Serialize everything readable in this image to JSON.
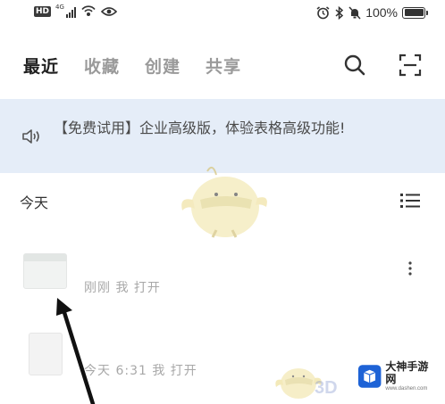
{
  "status_bar": {
    "hd_badge": "HD",
    "network_type": "4G",
    "battery_text": "100%",
    "battery_level": 1.0,
    "icons": [
      "hd-icon",
      "signal-icon",
      "wifi-hotspot-icon",
      "eye-icon",
      "alarm-icon",
      "bluetooth-icon",
      "mute-icon",
      "battery-icon"
    ]
  },
  "tabs": [
    {
      "label": "最近",
      "active": true
    },
    {
      "label": "收藏",
      "active": false
    },
    {
      "label": "创建",
      "active": false
    },
    {
      "label": "共享",
      "active": false
    }
  ],
  "header_icons": [
    "search-icon",
    "scan-icon"
  ],
  "banner": {
    "icon": "speaker-icon",
    "text": "【免费试用】企业高级版，体验表格高级功能!",
    "background": "#e5edf8"
  },
  "section": {
    "title": "今天",
    "view_icon": "list-view-icon"
  },
  "files": [
    {
      "type": "sheet",
      "meta": "刚刚 我 打开",
      "more_icon": "more-vertical-icon"
    },
    {
      "type": "doc",
      "meta": "今天 6:31 我 打开"
    }
  ],
  "watermark": {
    "text_3d": "3D",
    "site_name": "大神手游网",
    "site_url": "www.dashen.com"
  },
  "colors": {
    "active_tab": "#1f1f1f",
    "inactive_tab": "#9a9a9a",
    "meta_text": "#a8a8a8",
    "site_logo": "#1e63d6"
  }
}
